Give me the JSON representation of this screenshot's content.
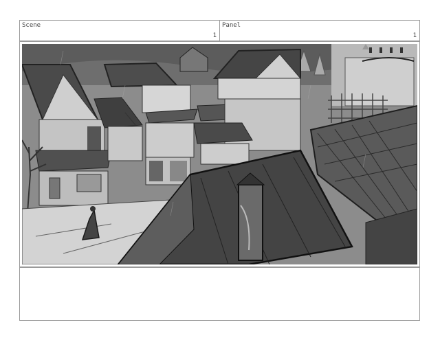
{
  "header": {
    "scene_label": "Scene",
    "scene_number": "1",
    "panel_label": "Panel",
    "panel_number": "1"
  },
  "notes": {
    "text": ""
  },
  "colors": {
    "border": "#9a9a9a",
    "sketch_dark": "#3a3a3a",
    "sketch_mid": "#7b7b7b",
    "sketch_light": "#c9c9c9"
  }
}
